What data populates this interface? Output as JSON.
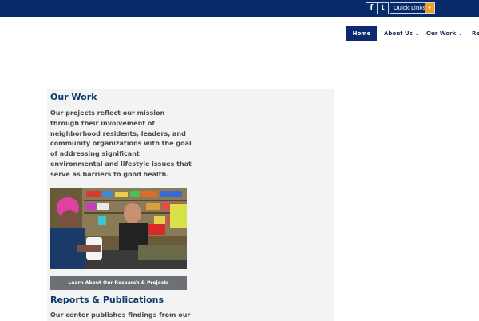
{
  "topbar": {
    "social": [
      {
        "label": "f",
        "icon": "facebook-icon"
      },
      {
        "label": "t",
        "icon": "twitter-icon"
      }
    ],
    "quick_links": {
      "label": "Quick Links",
      "arrow": "▾",
      "arrow_color": "#f0a020"
    },
    "background": "#072a6b"
  },
  "nav": {
    "items": [
      {
        "label": "Home",
        "active": true
      },
      {
        "label": "About Us"
      },
      {
        "label": "Our Work"
      },
      {
        "label": "Re"
      }
    ],
    "chevron": "⌄",
    "active_color": "#0b2a6f"
  },
  "main": {
    "our_work": {
      "heading": "Our Work",
      "body": "Our projects reflect our mission through their involvement of neighborhood residents, leaders, and community organizations with the goal of addressing significant environmental and lifestyle issues that serve as barriers to good health.",
      "button": "Learn About Our Research & Projects"
    },
    "reports": {
      "heading": "Reports & Publications",
      "body": "Our center publishes findings from our"
    },
    "heading_color": "#0b3a6b"
  }
}
